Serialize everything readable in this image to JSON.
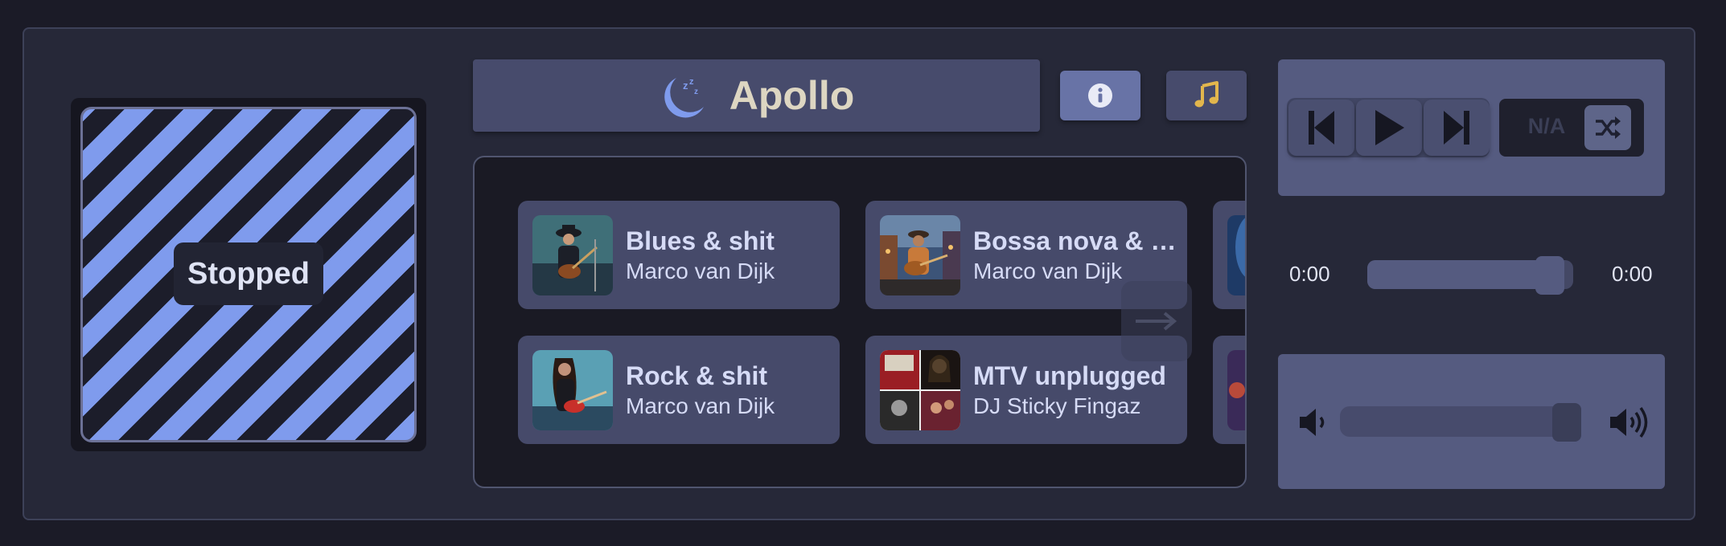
{
  "player": {
    "status": "Stopped",
    "title": "Apollo",
    "elapsed": "0:00",
    "duration": "0:00",
    "progress_fraction": 0.95,
    "volume_fraction": 1.0,
    "mode_label": "N/A"
  },
  "playlists": [
    {
      "name": "Blues & shit",
      "artist": "Marco van Dijk",
      "art": "blues"
    },
    {
      "name": "Bossa nova & shit",
      "artist": "Marco van Dijk",
      "art": "bossa"
    },
    {
      "name": "Rock & shit",
      "artist": "Marco van Dijk",
      "art": "rock"
    },
    {
      "name": "MTV unplugged",
      "artist": "DJ Sticky Fingaz",
      "art": "mtv"
    }
  ],
  "icons": {
    "title": "sleep-moon-icon",
    "info": "info-icon",
    "music": "music-note-icon",
    "previous": "skip-previous-icon",
    "play": "play-icon",
    "next": "skip-next-icon",
    "shuffle": "shuffle-icon",
    "volume_low": "volume-low-icon",
    "volume_high": "volume-high-icon",
    "scroll": "arrow-right-icon"
  },
  "colors": {
    "accent": "#7f9bed",
    "title_text": "#ddd6c2",
    "music_icon": "#e2b64d",
    "panel": "#555b80",
    "background": "#262838"
  }
}
